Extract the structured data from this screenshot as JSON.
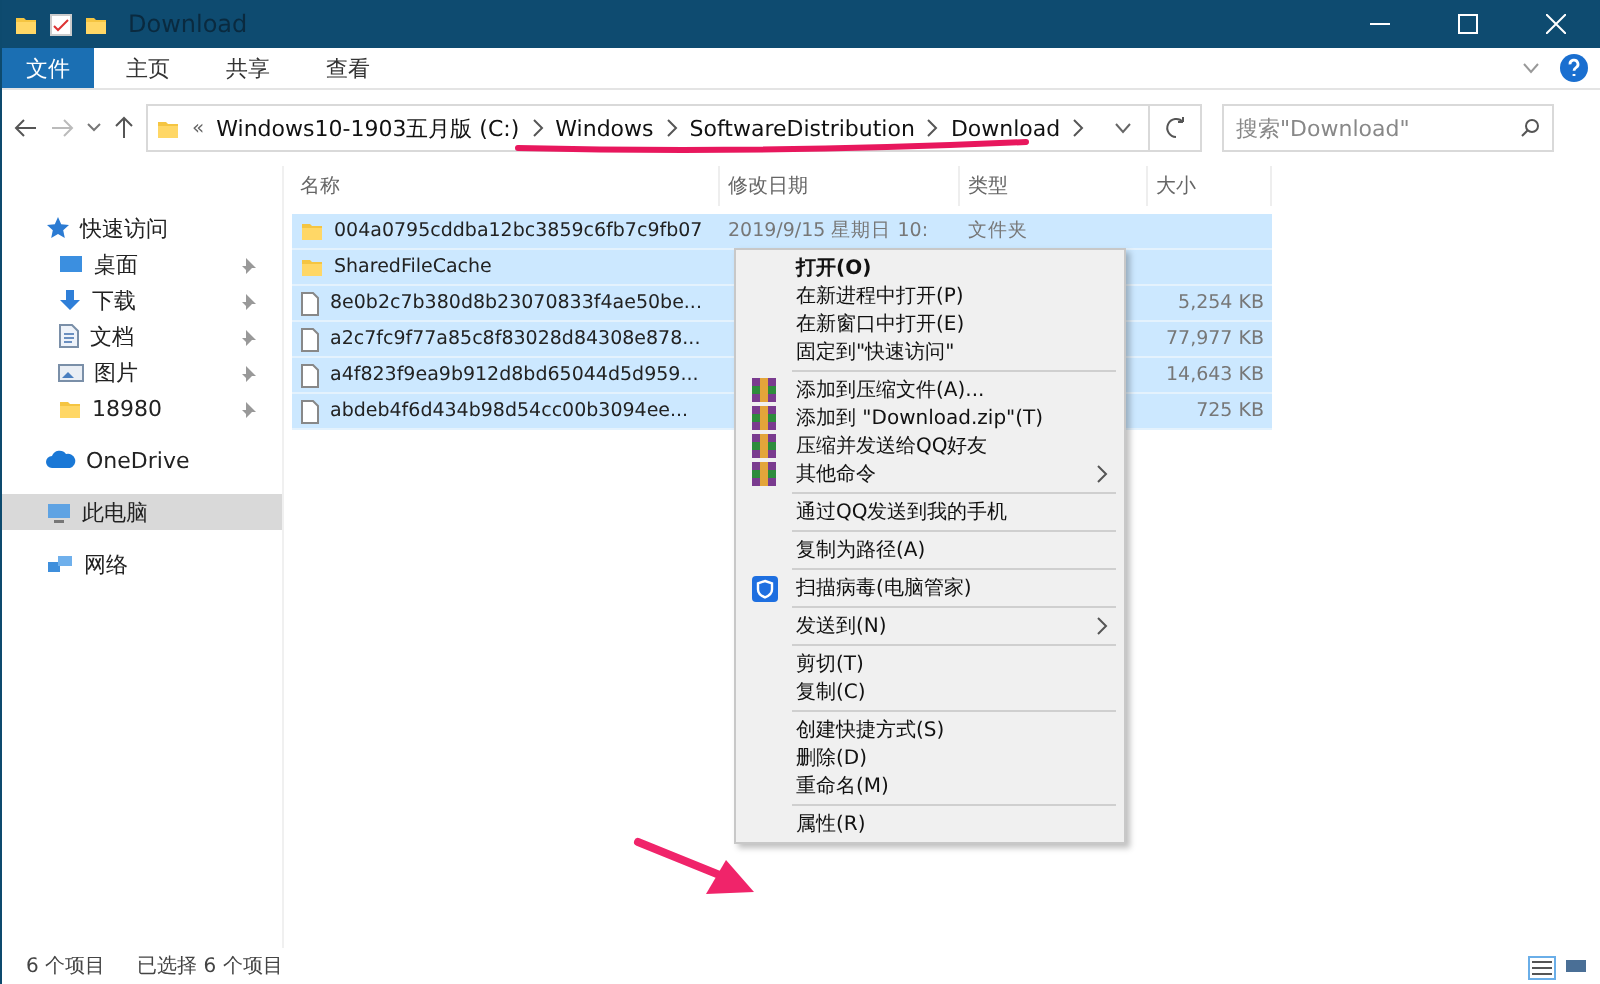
{
  "window": {
    "title": "Download"
  },
  "ribbon_tabs": [
    {
      "label": "文件",
      "selected": true
    },
    {
      "label": "主页",
      "selected": false
    },
    {
      "label": "共享",
      "selected": false
    },
    {
      "label": "查看",
      "selected": false
    }
  ],
  "address": {
    "overflow": "«",
    "crumbs": [
      "Windows10-1903五月版 (C:)",
      "Windows",
      "SoftwareDistribution",
      "Download"
    ]
  },
  "search": {
    "placeholder": "搜索\"Download\""
  },
  "sidebar": [
    {
      "label": "快速访问",
      "kind": "star",
      "pinned": false,
      "selected": false
    },
    {
      "label": "桌面",
      "kind": "desktop",
      "pinned": true,
      "selected": false
    },
    {
      "label": "下载",
      "kind": "download",
      "pinned": true,
      "selected": false
    },
    {
      "label": "文档",
      "kind": "document",
      "pinned": true,
      "selected": false
    },
    {
      "label": "图片",
      "kind": "picture",
      "pinned": true,
      "selected": false
    },
    {
      "label": "18980",
      "kind": "folder",
      "pinned": true,
      "selected": false
    },
    {
      "label": "OneDrive",
      "kind": "cloud",
      "pinned": false,
      "selected": false
    },
    {
      "label": "此电脑",
      "kind": "pc",
      "pinned": false,
      "selected": true
    },
    {
      "label": "网络",
      "kind": "network",
      "pinned": false,
      "selected": false
    }
  ],
  "table": {
    "columns": [
      "名称",
      "修改日期",
      "类型",
      "大小"
    ],
    "rows": [
      {
        "kind": "folder",
        "name": "004a0795cddba12bc3859c6fb7c9fb07",
        "date": "2019/9/15 星期日 10:",
        "type": "文件夹",
        "selected": true
      },
      {
        "kind": "folder",
        "name": "SharedFileCache",
        "selected": true
      },
      {
        "kind": "file",
        "name": "8e0b2c7b380d8b23070833f4ae50be...",
        "size": "5,254 KB",
        "selected": true
      },
      {
        "kind": "file",
        "name": "a2c7fc9f77a85c8f83028d84308e878...",
        "size": "77,977 KB",
        "selected": true
      },
      {
        "kind": "file",
        "name": "a4f823f9ea9b912d8bd65044d5d959...",
        "size": "14,643 KB",
        "selected": true
      },
      {
        "kind": "file",
        "name": "abdeb4f6d434b98d54cc00b3094ee...",
        "size": "725 KB",
        "selected": true
      }
    ]
  },
  "context_menu": [
    {
      "kind": "item",
      "label": "打开(O)",
      "default": true
    },
    {
      "kind": "item",
      "label": "在新进程中打开(P)"
    },
    {
      "kind": "item",
      "label": "在新窗口中打开(E)"
    },
    {
      "kind": "item",
      "label": "固定到\"快速访问\""
    },
    {
      "kind": "separator"
    },
    {
      "kind": "archive",
      "label": "添加到压缩文件(A)..."
    },
    {
      "kind": "archive",
      "label": "添加到 \"Download.zip\"(T)"
    },
    {
      "kind": "archive",
      "label": "压缩并发送给QQ好友"
    },
    {
      "kind": "archive",
      "label": "其他命令",
      "submenu": true
    },
    {
      "kind": "separator"
    },
    {
      "kind": "item",
      "label": "通过QQ发送到我的手机"
    },
    {
      "kind": "separator"
    },
    {
      "kind": "item",
      "label": "复制为路径(A)"
    },
    {
      "kind": "separator"
    },
    {
      "kind": "shield",
      "label": "扫描病毒(电脑管家)"
    },
    {
      "kind": "separator"
    },
    {
      "kind": "item",
      "label": "发送到(N)",
      "submenu": true
    },
    {
      "kind": "separator"
    },
    {
      "kind": "item",
      "label": "剪切(T)"
    },
    {
      "kind": "item",
      "label": "复制(C)"
    },
    {
      "kind": "separator"
    },
    {
      "kind": "item",
      "label": "创建快捷方式(S)"
    },
    {
      "kind": "item",
      "label": "删除(D)"
    },
    {
      "kind": "item",
      "label": "重命名(M)"
    },
    {
      "kind": "separator"
    },
    {
      "kind": "item",
      "label": "属性(R)"
    }
  ],
  "status_bar": {
    "count": "6 个项目",
    "selection": "已选择 6 个项目"
  }
}
